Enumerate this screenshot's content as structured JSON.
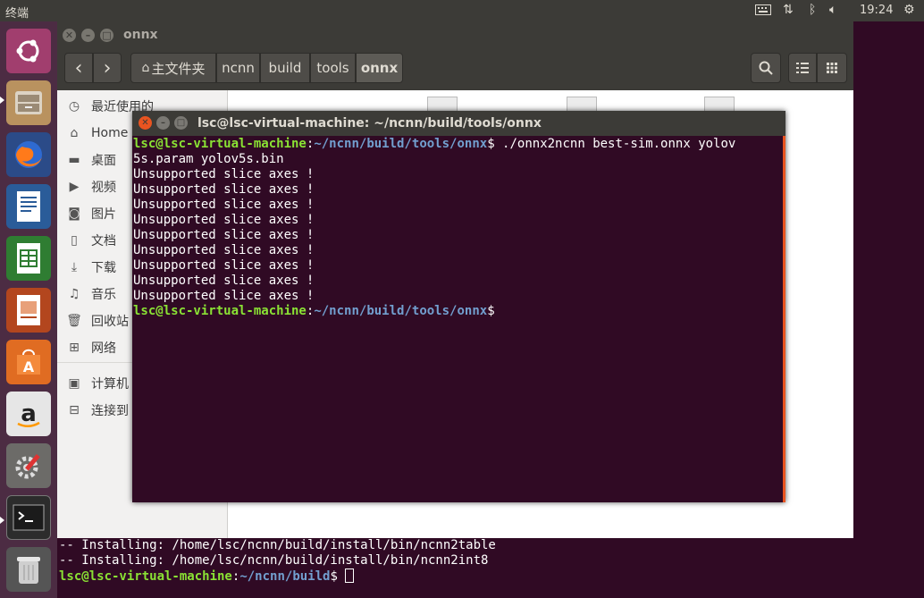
{
  "top_panel": {
    "title": "终端",
    "clock": "19:24",
    "indicators": [
      "keyboard-icon",
      "network-icon",
      "bluetooth-icon",
      "volume-icon",
      "gear-icon"
    ]
  },
  "launcher": {
    "items": [
      "ubuntu-dash-icon",
      "file-manager-icon",
      "firefox-icon",
      "libreoffice-writer-icon",
      "libreoffice-calc-icon",
      "libreoffice-impress-icon",
      "software-center-icon",
      "amazon-icon",
      "system-settings-icon",
      "terminal-icon",
      "trash-icon"
    ]
  },
  "file_manager": {
    "title": "onnx",
    "nav": {
      "back": "‹",
      "forward": "›"
    },
    "breadcrumbs": [
      "主文件夹",
      "ncnn",
      "build",
      "tools",
      "onnx"
    ],
    "sidebar": [
      "最近使用的",
      "Home",
      "桌面",
      "视频",
      "图片",
      "文档",
      "下载",
      "音乐",
      "回收站",
      "网络",
      "计算机",
      "连接到"
    ]
  },
  "terminal": {
    "title": "lsc@lsc-virtual-machine: ~/ncnn/build/tools/onnx",
    "prompt_user": "lsc@lsc-virtual-machine",
    "prompt_path": "~/ncnn/build/tools/onnx",
    "command": "$ ./onnx2ncnn best-sim.onnx yolov",
    "command_wrap": "5s.param yolov5s.bin",
    "outputs": [
      "Unsupported slice axes !",
      "Unsupported slice axes !",
      "Unsupported slice axes !",
      "Unsupported slice axes !",
      "Unsupported slice axes !",
      "Unsupported slice axes !",
      "Unsupported slice axes !",
      "Unsupported slice axes !",
      "Unsupported slice axes !"
    ],
    "final_prompt_user": "lsc@lsc-virtual-machine",
    "final_prompt_path": "~/ncnn/build/tools/onnx",
    "final_prompt_end": "$"
  },
  "bg_terminal": {
    "line1": "-- Installing: /home/lsc/ncnn/build/install/bin/ncnn2table",
    "line2": "-- Installing: /home/lsc/ncnn/build/install/bin/ncnn2int8",
    "prompt_user": "lsc@lsc-virtual-machine",
    "prompt_path": "~/ncnn/build",
    "prompt_end": "$ "
  }
}
